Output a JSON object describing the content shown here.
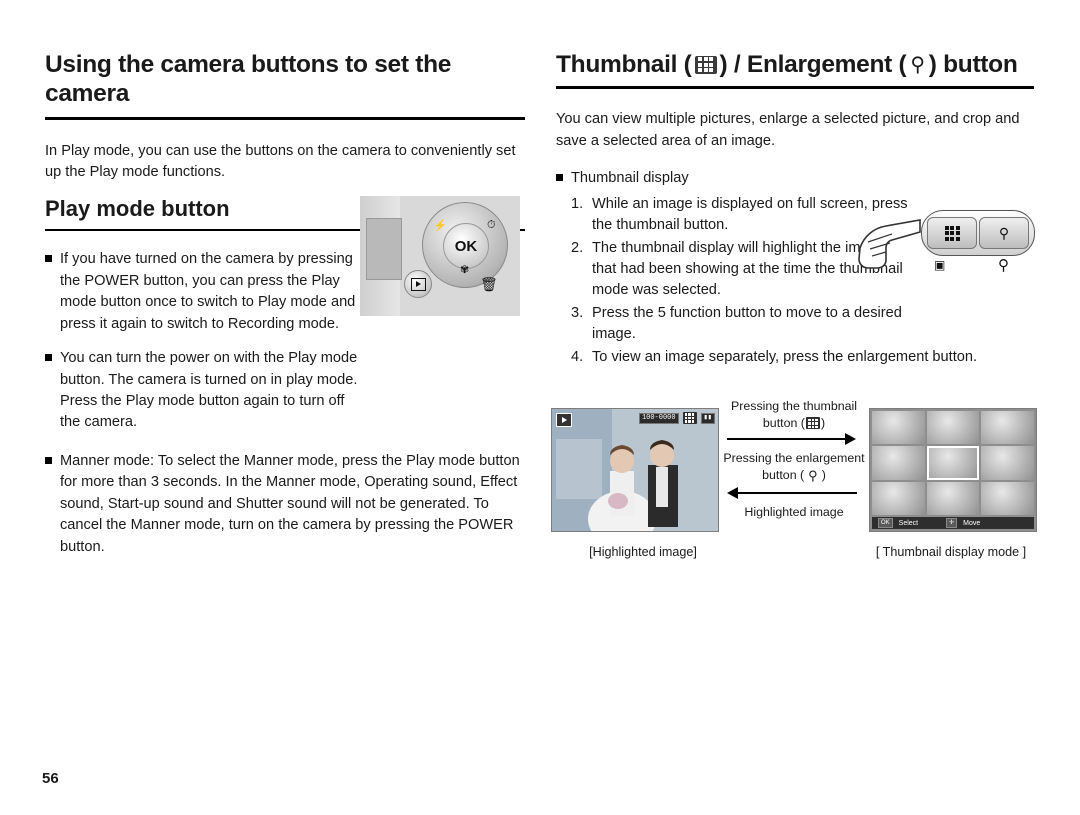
{
  "page": {
    "number": "56"
  },
  "left_column": {
    "heading": "Using the camera buttons to set the camera",
    "intro": "In Play mode, you can use the buttons on the camera to conveniently set up the Play mode functions.",
    "subheading": "Play mode button",
    "bullets": [
      "If you have turned on the camera by pressing the POWER button, you can press the Play mode button once to switch to Play mode and press it again to switch to Recording mode.",
      "You can turn the power on with the Play mode button. The camera is turned on in play mode. Press the Play mode button again to turn off the camera.",
      "Manner mode: To select the Manner mode, press the Play mode button for more than 3 seconds. In the Manner mode, Operating sound, Effect sound, Start-up sound and Shutter sound will not be generated. To cancel the Manner mode, turn on the camera by pressing the POWER button."
    ],
    "camera_dial": {
      "ok_label": "OK",
      "flash_icon": "flash-icon",
      "macro_icon": "macro-icon",
      "timer_icon": "self-timer-icon",
      "play_icon": "play-mode-icon",
      "delete_icon": "delete-icon"
    }
  },
  "right_column": {
    "heading_prefix": "Thumbnail (",
    "heading_middle": ") / Enlargement (",
    "heading_suffix": ") button",
    "thumbnail_icon": "thumbnail-grid-icon",
    "enlargement_icon": "magnifier-icon",
    "intro": "You can view multiple pictures, enlarge a selected picture, and crop and save a selected area of an image.",
    "bullet_label": "Thumbnail display",
    "steps": [
      {
        "n": "1.",
        "text": "While an image is displayed on full screen, press the thumbnail  button."
      },
      {
        "n": "2.",
        "text": "The thumbnail display will highlight the image that had been showing at the time the thumbnail mode was selected."
      },
      {
        "n": "3.",
        "text": "Press the 5 function button to move to a desired image."
      },
      {
        "n": "4.",
        "text": "To view an image separately, press the enlargement button."
      }
    ],
    "figure": {
      "arrow_top_label_1": "Pressing the thumbnail",
      "arrow_top_label_2": "button (",
      "arrow_top_label_3": ")",
      "arrow_bottom_label_1": "Pressing the enlargement",
      "arrow_bottom_label_2": "button (",
      "arrow_bottom_label_3": ")",
      "highlighted_image_label": "Highlighted image",
      "caption_left": "[Highlighted image]",
      "caption_right": "[ Thumbnail display mode ]",
      "osd_counter": "100-0000",
      "thumb_bar_select": "Select",
      "thumb_bar_move": "Move"
    }
  }
}
